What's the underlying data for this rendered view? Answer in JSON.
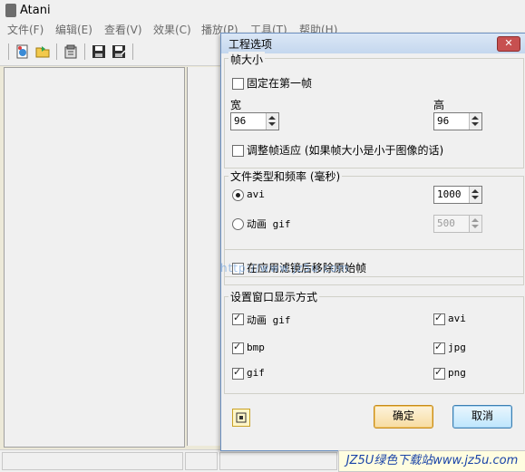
{
  "window": {
    "title": "Atani"
  },
  "menu": [
    "文件(F)",
    "编辑(E)",
    "查看(V)",
    "效果(C)",
    "播放(P)",
    "工具(T)",
    "帮助(H)"
  ],
  "dialog": {
    "title": "工程选项",
    "close": "✕",
    "frame_size": {
      "group_label": "帧大小",
      "fix_first_label": "固定在第一帧",
      "fix_first_checked": false,
      "width_label": "宽",
      "width_value": "96",
      "height_label": "高",
      "height_value": "96",
      "fit_label": "调整帧适应 (如果帧大小是小于图像的话)",
      "fit_checked": false
    },
    "file_type": {
      "group_label": "文件类型和频率 (毫秒)",
      "avi_label": "avi",
      "avi_selected": true,
      "avi_rate": "1000",
      "gif_label": "动画 gif",
      "gif_selected": false,
      "gif_rate": "500"
    },
    "filter": {
      "label": "在应用滤镜后移除原始帧",
      "checked": false
    },
    "display": {
      "group_label": "设置窗口显示方式",
      "items": [
        {
          "label": "动画 gif",
          "checked": true
        },
        {
          "label": "avi",
          "checked": true
        },
        {
          "label": "bmp",
          "checked": true
        },
        {
          "label": "jpg",
          "checked": true
        },
        {
          "label": "gif",
          "checked": true
        },
        {
          "label": "png",
          "checked": true
        }
      ]
    },
    "ok_label": "确定",
    "cancel_label": "取消"
  },
  "overlay": {
    "watermark_text": "http://www.jz5u.com",
    "corner_text": "JZ5U绿色下载站www.jz5u.com"
  },
  "colors": {
    "title_gradient": "#c4d7ee",
    "close_red": "#c75050",
    "ok_orange": "#f7dca0",
    "cancel_blue": "#bee6fd"
  }
}
